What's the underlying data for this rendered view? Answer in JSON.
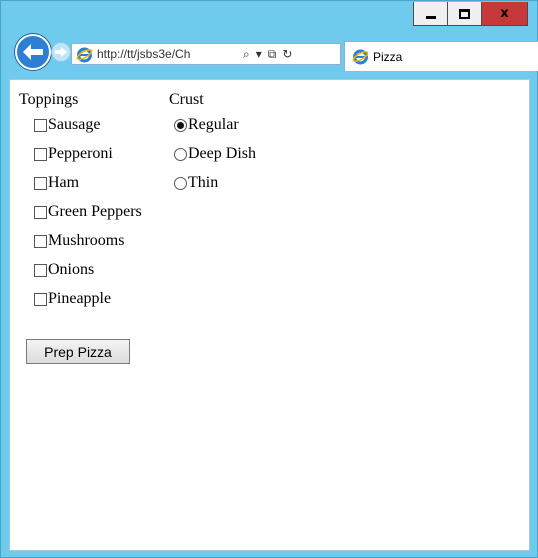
{
  "window": {
    "frame_color": "#6fcbee",
    "close_color": "#c7383a",
    "close_glyph": "x"
  },
  "browser": {
    "url": "http://tt/jsbs3e/Ch",
    "tab_title": "Pizza",
    "address_tools": {
      "search_glyph": "⌕",
      "dropdown_glyph": "▾",
      "compat_glyph": "⧉",
      "refresh_glyph": "↻"
    },
    "icons": {
      "back": "back-arrow-icon",
      "forward": "forward-arrow-icon",
      "ie": "internet-explorer-icon"
    }
  },
  "form": {
    "toppings_heading": "Toppings",
    "crust_heading": "Crust",
    "toppings": [
      {
        "label": "Sausage",
        "checked": false
      },
      {
        "label": "Pepperoni",
        "checked": false
      },
      {
        "label": "Ham",
        "checked": false
      },
      {
        "label": "Green Peppers",
        "checked": false
      },
      {
        "label": "Mushrooms",
        "checked": false
      },
      {
        "label": "Onions",
        "checked": false
      },
      {
        "label": "Pineapple",
        "checked": false
      }
    ],
    "crusts": [
      {
        "label": "Regular",
        "checked": true
      },
      {
        "label": "Deep Dish",
        "checked": false
      },
      {
        "label": "Thin",
        "checked": false
      }
    ],
    "submit_label": "Prep Pizza"
  }
}
